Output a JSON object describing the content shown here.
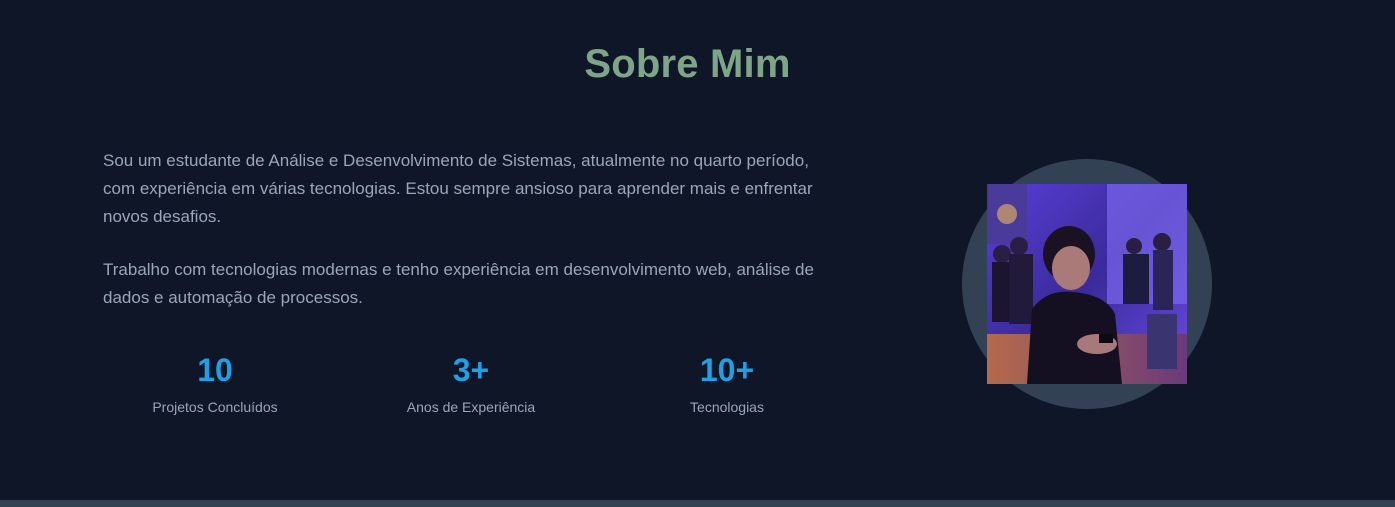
{
  "about": {
    "title": "Sobre Mim",
    "paragraph_1": "Sou um estudante de Análise e Desenvolvimento de Sistemas, atualmente no quarto período, com experiência em várias tecnologias. Estou sempre ansioso para aprender mais e enfrentar novos desafios.",
    "paragraph_2": "Trabalho com tecnologias modernas e tenho experiência em desenvolvimento web, análise de dados e automação de processos."
  },
  "stats": [
    {
      "value": "10",
      "label": "Projetos Concluídos"
    },
    {
      "value": "3+",
      "label": "Anos de Experiência"
    },
    {
      "value": "10+",
      "label": "Tecnologias"
    }
  ],
  "colors": {
    "background": "#0e1627",
    "title": "#7fa589",
    "text": "#9aa7b9",
    "accent": "#1ea0e6",
    "avatar_ring": "#334155"
  }
}
